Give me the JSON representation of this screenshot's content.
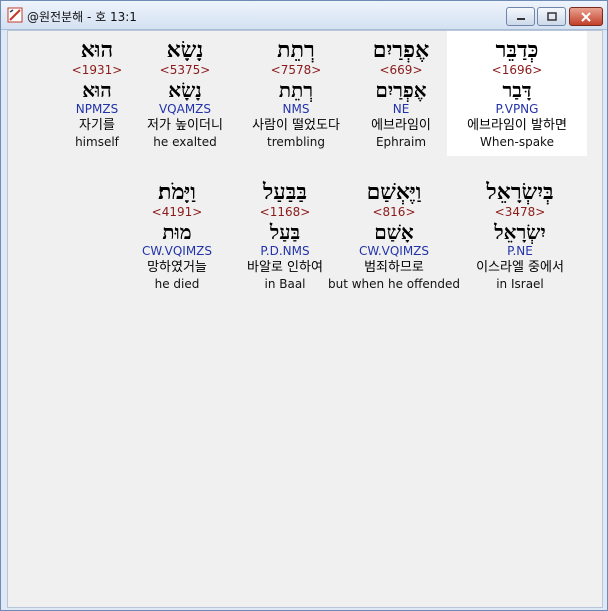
{
  "window": {
    "title": "@원전분해 - 호 13:1"
  },
  "rows": [
    [
      {
        "heb": "כְּדַבֵּר",
        "strong": "<1696>",
        "lemma": "דָּבַר",
        "parse": "P.VPNG",
        "kor": "에브라임이 발하면",
        "eng": "When-spake",
        "highlighted": true
      },
      {
        "heb": "אֶפְרַיִם",
        "strong": "<669>",
        "lemma": "אֶפְרַיִם",
        "parse": "NE",
        "kor": "에브라임이",
        "eng": "Ephraim",
        "highlighted": false
      },
      {
        "heb": "רְתֵת",
        "strong": "<7578>",
        "lemma": "רְתֵת",
        "parse": "NMS",
        "kor": "사람이 떨었도다",
        "eng": "trembling",
        "highlighted": false
      },
      {
        "heb": "נָשָׂא",
        "strong": "<5375>",
        "lemma": "נָשָׂא",
        "parse": "VQAMZS",
        "kor": "저가 높이더니",
        "eng": "he exalted",
        "highlighted": false
      },
      {
        "heb": "הוּא",
        "strong": "<1931>",
        "lemma": "הוּא",
        "parse": "NPMZS",
        "kor": "자기를",
        "eng": "himself",
        "highlighted": false
      }
    ],
    [
      {
        "heb": "בְּיִשְׂרָאֵל",
        "strong": "<3478>",
        "lemma": "יִשְׂרָאֵל",
        "parse": "P.NE",
        "kor": "이스라엘 중에서",
        "eng": "in Israel",
        "highlighted": false
      },
      {
        "heb": "וַיֶּאְשַׁם",
        "strong": "<816>",
        "lemma": "אָשַׁם",
        "parse": "CW.VQIMZS",
        "kor": "범죄하므로",
        "eng": "but when he offended",
        "highlighted": false
      },
      {
        "heb": "בַּבַּעַל",
        "strong": "<1168>",
        "lemma": "בַּעַל",
        "parse": "P.D.NMS",
        "kor": "바알로 인하여",
        "eng": "in Baal",
        "highlighted": false
      },
      {
        "heb": "וַיָּמֹת׃",
        "strong": "<4191>",
        "lemma": "מוּת",
        "parse": "CW.VQIMZS",
        "kor": "망하였거늘",
        "eng": "he died",
        "highlighted": false
      }
    ]
  ]
}
